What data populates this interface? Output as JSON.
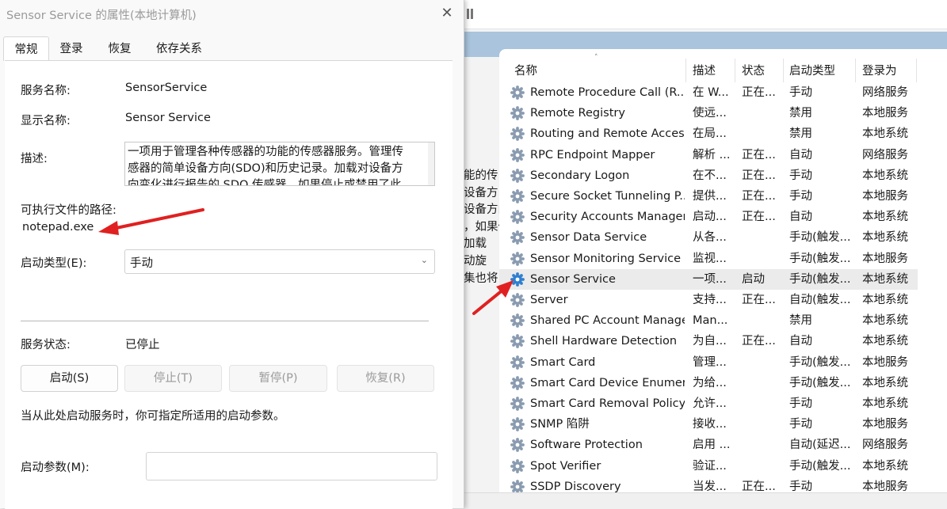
{
  "dialog": {
    "title": "Sensor Service 的属性(本地计算机)",
    "close_glyph": "✕",
    "tabs": [
      {
        "label": "常规",
        "active": true
      },
      {
        "label": "登录",
        "active": false
      },
      {
        "label": "恢复",
        "active": false
      },
      {
        "label": "依存关系",
        "active": false
      }
    ],
    "service_name_label": "服务名称:",
    "service_name_value": "SensorService",
    "display_name_label": "显示名称:",
    "display_name_value": "Sensor Service",
    "description_label": "描述:",
    "description_value": "一项用于管理各种传感器的功能的传感器服务。管理传感器的简单设备方向(SDO)和历史记录。加载对设备方向变化进行报告的 SDO 传感器。如果停止或禁用了此",
    "exe_path_label": "可执行文件的路径:",
    "exe_path_value": "notepad.exe",
    "startup_type_label": "启动类型(E):",
    "startup_type_value": "手动",
    "service_status_label": "服务状态:",
    "service_status_value": "已停止",
    "buttons": {
      "start": "启动(S)",
      "stop": "停止(T)",
      "pause": "暂停(P)",
      "resume": "恢复(R)"
    },
    "hint_text": "当从此处启动服务时，你可指定所适用的启动参数。",
    "start_params_label": "启动参数(M):",
    "start_params_value": ""
  },
  "services_window": {
    "desc_pane_lines": [
      "能的传",
      "设备方",
      "设备方向",
      "，如果停",
      "加载",
      "动旋",
      "集也将"
    ],
    "columns": [
      "名称",
      "描述",
      "状态",
      "启动类型",
      "登录为"
    ],
    "rows": [
      {
        "name": "Remote Procedure Call (R...",
        "desc": "在 W...",
        "status": "正在...",
        "startup": "手动",
        "logon": "网络服务"
      },
      {
        "name": "Remote Registry",
        "desc": "使远...",
        "status": "",
        "startup": "禁用",
        "logon": "本地服务"
      },
      {
        "name": "Routing and Remote Access",
        "desc": "在局...",
        "status": "",
        "startup": "禁用",
        "logon": "本地系统"
      },
      {
        "name": "RPC Endpoint Mapper",
        "desc": "解析 ...",
        "status": "正在...",
        "startup": "自动",
        "logon": "网络服务"
      },
      {
        "name": "Secondary Logon",
        "desc": "在不...",
        "status": "正在...",
        "startup": "手动",
        "logon": "本地系统"
      },
      {
        "name": "Secure Socket Tunneling P...",
        "desc": "提供...",
        "status": "正在...",
        "startup": "手动",
        "logon": "本地服务"
      },
      {
        "name": "Security Accounts Manager",
        "desc": "启动...",
        "status": "正在...",
        "startup": "自动",
        "logon": "本地系统"
      },
      {
        "name": "Sensor Data Service",
        "desc": "从各...",
        "status": "",
        "startup": "手动(触发...",
        "logon": "本地系统"
      },
      {
        "name": "Sensor Monitoring Service",
        "desc": "监视...",
        "status": "",
        "startup": "手动(触发...",
        "logon": "本地服务"
      },
      {
        "name": "Sensor Service",
        "desc": "一项...",
        "status": "启动",
        "startup": "手动(触发...",
        "logon": "本地系统",
        "selected": true
      },
      {
        "name": "Server",
        "desc": "支持...",
        "status": "正在...",
        "startup": "自动(触发...",
        "logon": "本地系统"
      },
      {
        "name": "Shared PC Account Manager",
        "desc": "Man...",
        "status": "",
        "startup": "禁用",
        "logon": "本地系统"
      },
      {
        "name": "Shell Hardware Detection",
        "desc": "为自...",
        "status": "正在...",
        "startup": "自动",
        "logon": "本地系统"
      },
      {
        "name": "Smart Card",
        "desc": "管理...",
        "status": "",
        "startup": "手动(触发...",
        "logon": "本地服务"
      },
      {
        "name": "Smart Card Device Enumer...",
        "desc": "为给...",
        "status": "",
        "startup": "手动(触发...",
        "logon": "本地系统"
      },
      {
        "name": "Smart Card Removal Policy",
        "desc": "允许...",
        "status": "",
        "startup": "手动",
        "logon": "本地系统"
      },
      {
        "name": "SNMP 陷阱",
        "desc": "接收...",
        "status": "",
        "startup": "手动",
        "logon": "本地服务"
      },
      {
        "name": "Software Protection",
        "desc": "启用 ...",
        "status": "",
        "startup": "自动(延迟...",
        "logon": "网络服务"
      },
      {
        "name": "Spot Verifier",
        "desc": "验证...",
        "status": "",
        "startup": "手动(触发...",
        "logon": "本地系统"
      },
      {
        "name": "SSDP Discovery",
        "desc": "当发...",
        "status": "正在...",
        "startup": "手动",
        "logon": "本地服务"
      }
    ]
  },
  "colors": {
    "arrow": "#e02020",
    "selected_row": "#ebebeb",
    "band": "#a9c4dc",
    "gear_selected": "#2f7fd0",
    "gear_normal": "#8a9bb0"
  },
  "icons": [
    "gear-icon",
    "close-icon",
    "chevron-down-icon",
    "sort-caret-icon",
    "arrow-annotation"
  ]
}
